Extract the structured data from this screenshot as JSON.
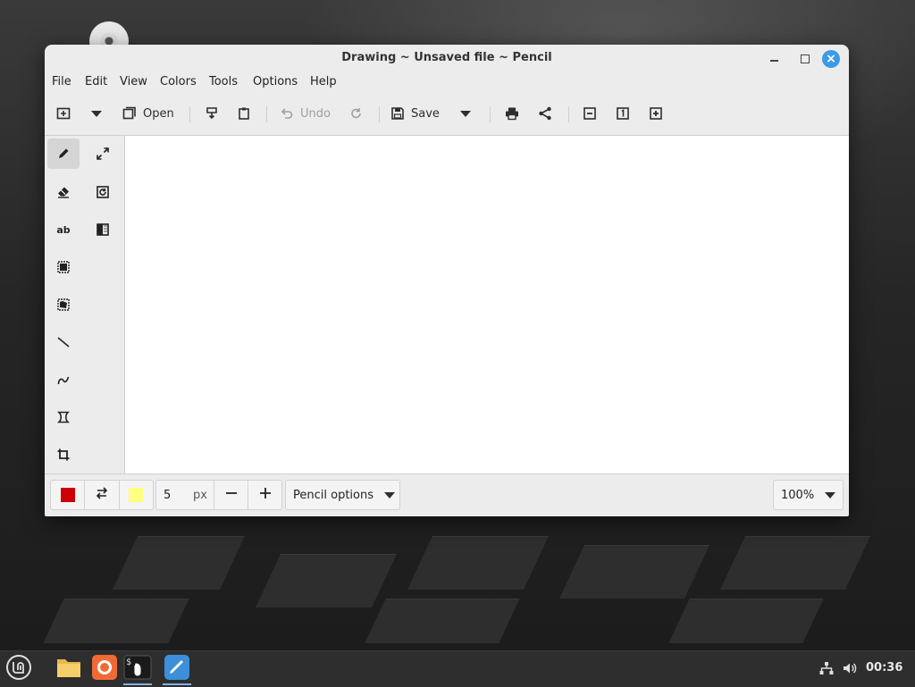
{
  "window": {
    "title": "Drawing ~ Unsaved file ~ Pencil"
  },
  "menubar": {
    "items": [
      "File",
      "Edit",
      "View",
      "Colors",
      "Tools",
      "Options",
      "Help"
    ]
  },
  "toolbar": {
    "open_label": "Open",
    "undo_label": "Undo",
    "save_label": "Save"
  },
  "tools": [
    {
      "name": "pencil",
      "icon": "pencil-icon",
      "active": true
    },
    {
      "name": "scale",
      "icon": "scale-arrows-icon"
    },
    {
      "name": "eraser",
      "icon": "eraser-icon"
    },
    {
      "name": "rotate",
      "icon": "rotate-icon"
    },
    {
      "name": "text",
      "icon": "text-ab-icon",
      "label": "ab"
    },
    {
      "name": "filters",
      "icon": "filters-icon"
    },
    {
      "name": "rect-select",
      "icon": "rectangle-selection-icon"
    },
    {
      "name": "free-select",
      "icon": "free-selection-icon"
    },
    {
      "name": "line",
      "icon": "line-icon"
    },
    {
      "name": "curve",
      "icon": "curve-icon"
    },
    {
      "name": "shape",
      "icon": "shape-icon"
    },
    {
      "name": "crop",
      "icon": "crop-icon"
    }
  ],
  "bottombar": {
    "main_color": "#cc0000",
    "secondary_color": "#ffff80",
    "size_value": "5",
    "size_unit": "px",
    "options_label": "Pencil options",
    "zoom_label": "100%"
  },
  "taskbar": {
    "clock": "00:36",
    "apps": [
      "mint-menu-icon",
      "files-folder-icon",
      "firefox-icon",
      "terminal-icon",
      "drawing-app-icon"
    ]
  }
}
